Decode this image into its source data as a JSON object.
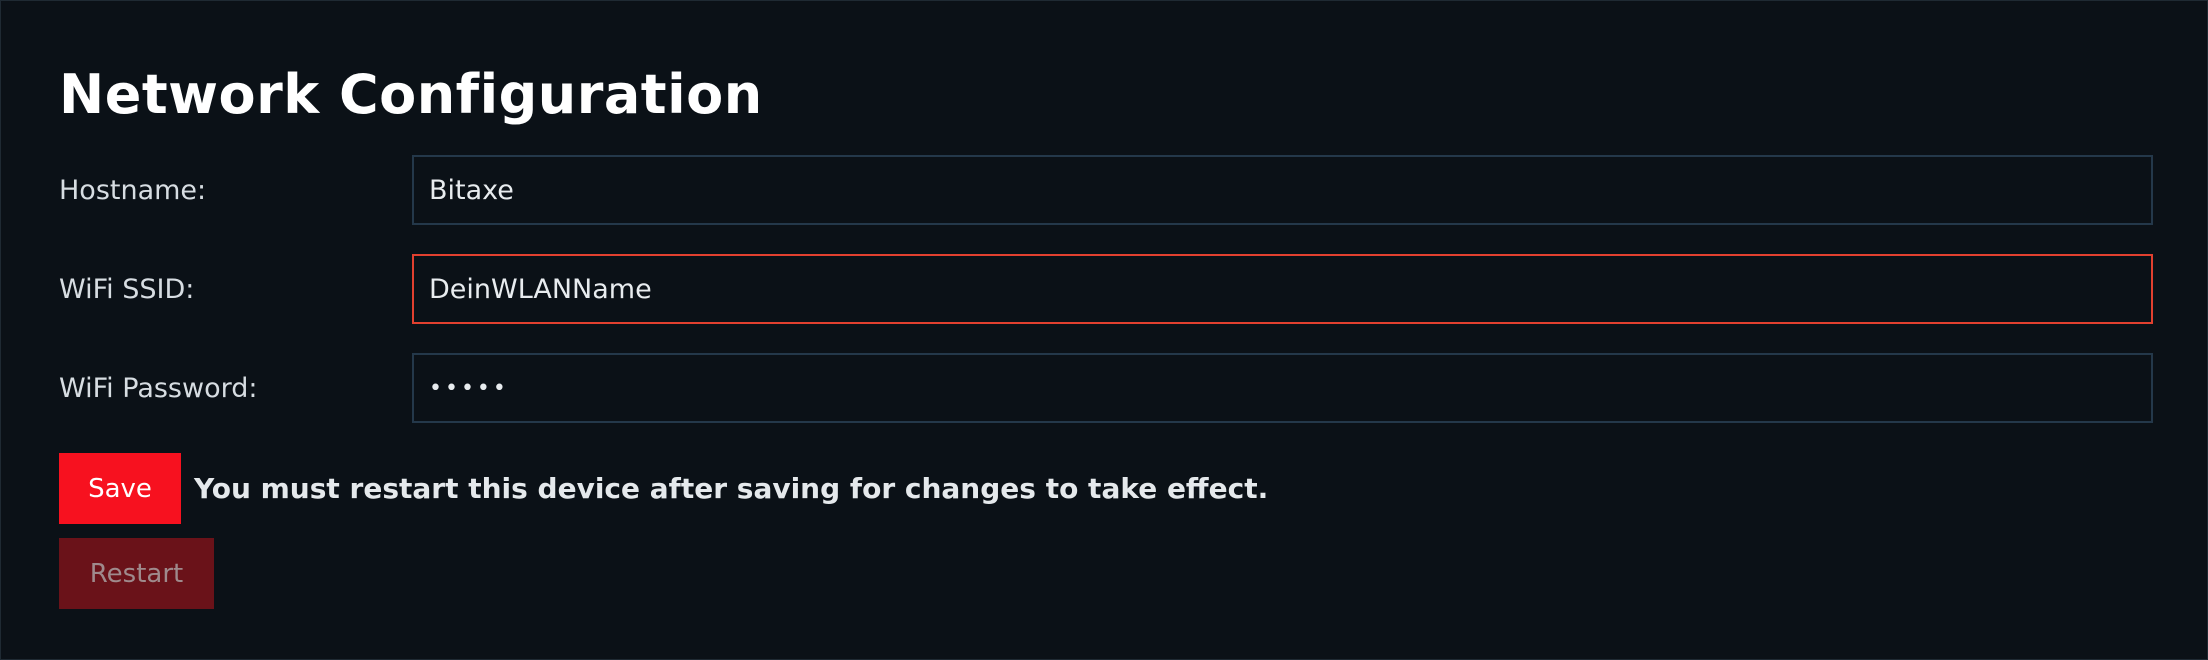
{
  "section": {
    "title": "Network Configuration"
  },
  "form": {
    "hostname": {
      "label": "Hostname:",
      "value": "Bitaxe"
    },
    "ssid": {
      "label": "WiFi SSID:",
      "value": "DeinWLANName",
      "state": "invalid"
    },
    "password": {
      "label": "WiFi Password:",
      "value": "•••••"
    }
  },
  "actions": {
    "save_label": "Save",
    "restart_label": "Restart",
    "restart_note": "You must restart this device after saving for changes to take effect."
  },
  "colors": {
    "background": "#0b1117",
    "input_border": "#24384a",
    "invalid_border": "#e2402f",
    "primary_button": "#f7111f",
    "disabled_button": "#6a1219"
  }
}
